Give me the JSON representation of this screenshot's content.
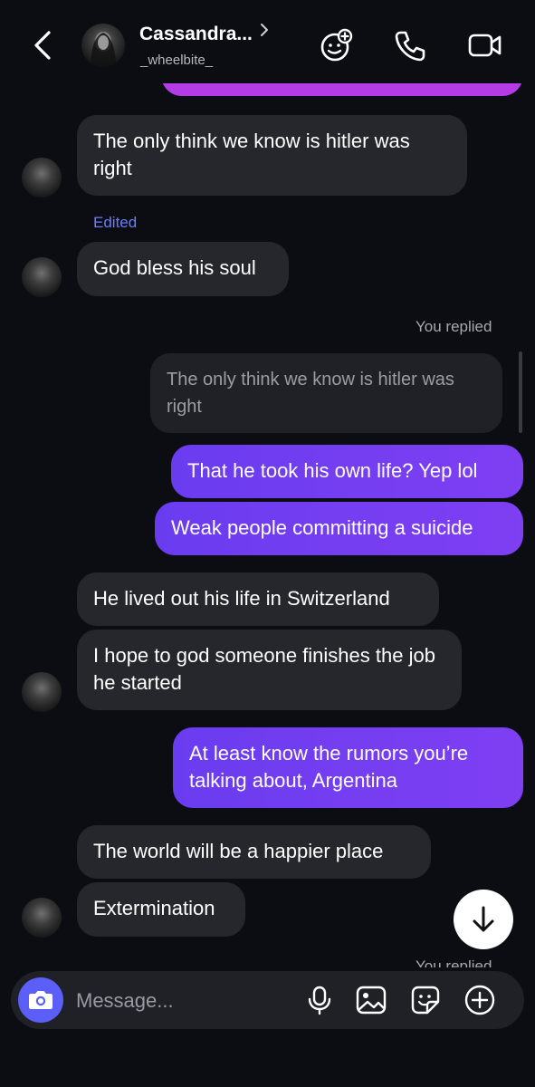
{
  "header": {
    "back_icon": "chevron-left-icon",
    "contact_name": "Cassandra...",
    "username": "_wheelbite_",
    "icons": [
      "effects-icon",
      "phone-icon",
      "video-icon"
    ]
  },
  "messages": [
    {
      "from": "them",
      "text": "The only think we know is hitler was right"
    },
    {
      "from": "them",
      "edited_label": "Edited",
      "text": "God bless his soul"
    },
    {
      "from": "me",
      "reply_label": "You replied",
      "quoted": "The only think we know is hitler was right",
      "text": "That he took his own life? Yep lol"
    },
    {
      "from": "me",
      "text": "Weak people committing a suicide"
    },
    {
      "from": "them",
      "text": "He lived out his life in Switzerland"
    },
    {
      "from": "them",
      "text": "I hope to god someone finishes the job he started"
    },
    {
      "from": "me",
      "text": "At least know the rumors you’re talking about, Argentina"
    },
    {
      "from": "them",
      "text": "The world will be a happier place"
    },
    {
      "from": "them",
      "text": "Extermination"
    },
    {
      "from": "me",
      "reply_label": "You replied"
    }
  ],
  "composer": {
    "placeholder": "Message...",
    "icons": [
      "camera-icon",
      "microphone-icon",
      "gallery-icon",
      "sticker-icon",
      "plus-circle-icon"
    ]
  },
  "scroll_button_icon": "arrow-down-icon",
  "colors": {
    "background": "#0b0d13",
    "incoming_bubble": "#26272d",
    "outgoing_bubble": "#7040f2",
    "edited_label": "#6c7cff",
    "camera_button": "#5b5ff8"
  }
}
